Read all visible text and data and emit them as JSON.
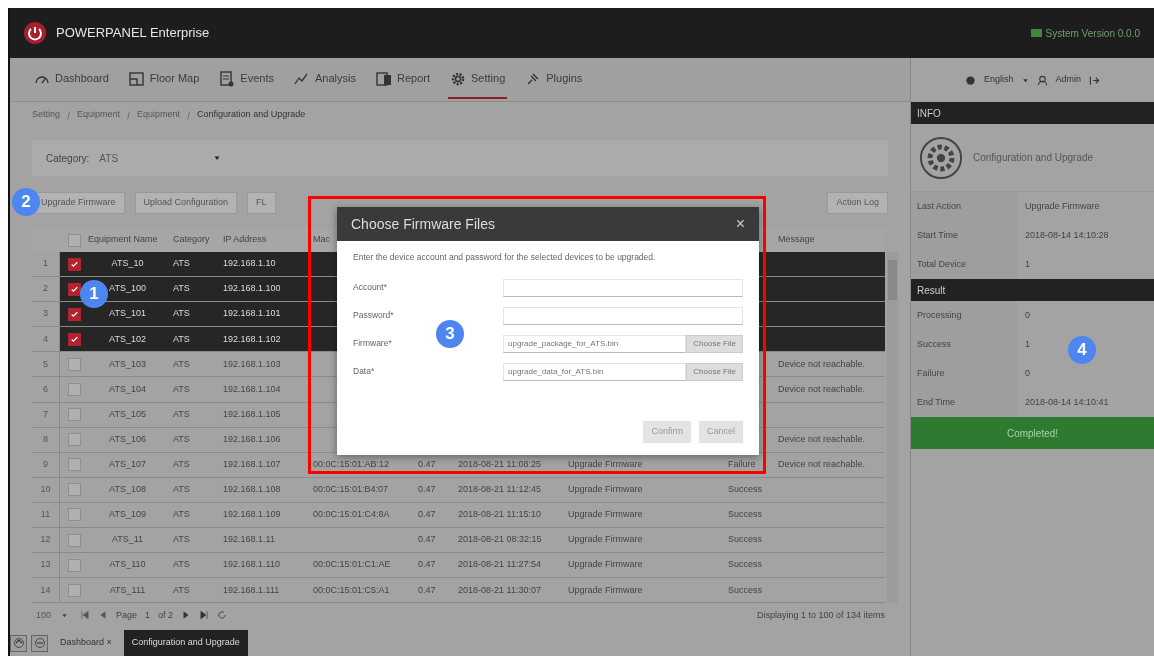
{
  "app": {
    "title": "POWERPANEL Enterprise",
    "version": "System Version 0.0.0"
  },
  "nav": [
    {
      "label": "Dashboard",
      "selected": false
    },
    {
      "label": "Floor Map",
      "selected": false
    },
    {
      "label": "Events",
      "selected": false
    },
    {
      "label": "Analysis",
      "selected": false
    },
    {
      "label": "Report",
      "selected": false
    },
    {
      "label": "Setting",
      "selected": true
    },
    {
      "label": "Plugins",
      "selected": false
    }
  ],
  "user": {
    "language": "English",
    "name": "Admin"
  },
  "breadcrumb": [
    "Setting",
    "Equipment",
    "Equipment",
    "Configuration and Upgrade"
  ],
  "filter": {
    "label": "Category:",
    "value": "ATS"
  },
  "actions": [
    "Upgrade Firmware",
    "Upload Configuration",
    "FL"
  ],
  "action_log": "Action Log",
  "table": {
    "select_all_checked": false,
    "columns": [
      "Equipment Name",
      "Category",
      "IP Address",
      "Mac"
    ],
    "last_column": "Message",
    "rows": [
      {
        "no": "1",
        "checked": true,
        "name": "ATS_10",
        "category": "ATS",
        "ip": "192.168.1.10"
      },
      {
        "no": "2",
        "checked": true,
        "name": "ATS_100",
        "category": "ATS",
        "ip": "192.168.1.100"
      },
      {
        "no": "3",
        "checked": true,
        "name": "ATS_101",
        "category": "ATS",
        "ip": "192.168.1.101"
      },
      {
        "no": "4",
        "checked": true,
        "name": "ATS_102",
        "category": "ATS",
        "ip": "192.168.1.102"
      },
      {
        "no": "5",
        "checked": false,
        "name": "ATS_103",
        "category": "ATS",
        "ip": "192.168.1.103",
        "message": "Device not reachable."
      },
      {
        "no": "6",
        "checked": false,
        "name": "ATS_104",
        "category": "ATS",
        "ip": "192.168.1.104",
        "message": "Device not reachable."
      },
      {
        "no": "7",
        "checked": false,
        "name": "ATS_105",
        "category": "ATS",
        "ip": "192.168.1.105"
      },
      {
        "no": "8",
        "checked": false,
        "name": "ATS_106",
        "category": "ATS",
        "ip": "192.168.1.106",
        "message": "Device not reachable."
      },
      {
        "no": "9",
        "checked": false,
        "name": "ATS_107",
        "category": "ATS",
        "ip": "192.168.1.107",
        "mac": "00:0C:15:01:AB:12",
        "version": "0.47",
        "time": "2018-08-21 11:08:25",
        "action": "Upgrade Firmware",
        "status": "Failure",
        "message": "Device not reachable."
      },
      {
        "no": "10",
        "checked": false,
        "name": "ATS_108",
        "category": "ATS",
        "ip": "192.168.1.108",
        "mac": "00:0C:15:01:B4:07",
        "version": "0.47",
        "time": "2018-08-21 11:12:45",
        "action": "Upgrade Firmware",
        "status": "Success"
      },
      {
        "no": "11",
        "checked": false,
        "name": "ATS_109",
        "category": "ATS",
        "ip": "192.168.1.109",
        "mac": "00:0C:15:01:C4:8A",
        "version": "0.47",
        "time": "2018-08-21 11:15:10",
        "action": "Upgrade Firmware",
        "status": "Success"
      },
      {
        "no": "12",
        "checked": false,
        "name": "ATS_11",
        "category": "ATS",
        "ip": "192.168.1.11",
        "version": "0.47",
        "time": "2018-08-21 08:32:15",
        "action": "Upgrade Firmware",
        "status": "Success"
      },
      {
        "no": "13",
        "checked": false,
        "name": "ATS_110",
        "category": "ATS",
        "ip": "192.168.1.110",
        "mac": "00:0C:15:01:C1:AE",
        "version": "0.47",
        "time": "2018-08-21 11:27:54",
        "action": "Upgrade Firmware",
        "status": "Success"
      },
      {
        "no": "14",
        "checked": false,
        "name": "ATS_111",
        "category": "ATS",
        "ip": "192.168.1.111",
        "mac": "00:0C:15:01:C5:A1",
        "version": "0.47",
        "time": "2018-08-21 11:30:07",
        "action": "Upgrade Firmware",
        "status": "Success"
      }
    ]
  },
  "pager": {
    "page_size": "100",
    "page_label": "Page",
    "page": "1",
    "of": "of 2",
    "summary": "Displaying 1 to 100 of 134 items"
  },
  "bottom_tabs": [
    {
      "label": "Dashboard",
      "close": "×",
      "selected": false
    },
    {
      "label": "Configuration and Upgrade",
      "selected": true
    }
  ],
  "info": {
    "header": "INFO",
    "title": "Configuration and Upgrade",
    "details": [
      {
        "label": "Last Action",
        "value": "Upgrade Firmware"
      },
      {
        "label": "Start Time",
        "value": "2018-08-14 14:10:28"
      },
      {
        "label": "Total Device",
        "value": "1"
      }
    ],
    "result_header": "Result",
    "results": [
      {
        "label": "Processing",
        "value": "0"
      },
      {
        "label": "Success",
        "value": "1"
      },
      {
        "label": "Failure",
        "value": "0"
      },
      {
        "label": "End Time",
        "value": "2018-08-14 14:10:41"
      }
    ],
    "status": "Completed!"
  },
  "dialog": {
    "title": "Choose Firmware Files",
    "close": "×",
    "intro": "Enter the device account and password for the selected devices to be upgraded.",
    "fields": [
      {
        "label": "Account*",
        "kind": "text"
      },
      {
        "label": "Password*",
        "kind": "text"
      },
      {
        "label": "Firmware*",
        "kind": "file",
        "placeholder": "upgrade_package_for_ATS.bin",
        "button": "Choose File"
      },
      {
        "label": "Data*",
        "kind": "file",
        "placeholder": "upgrade_data_for_ATS.bin",
        "button": "Choose File"
      }
    ],
    "buttons": [
      "Confirm",
      "Cancel"
    ]
  },
  "callouts": [
    "1",
    "2",
    "3",
    "4"
  ]
}
